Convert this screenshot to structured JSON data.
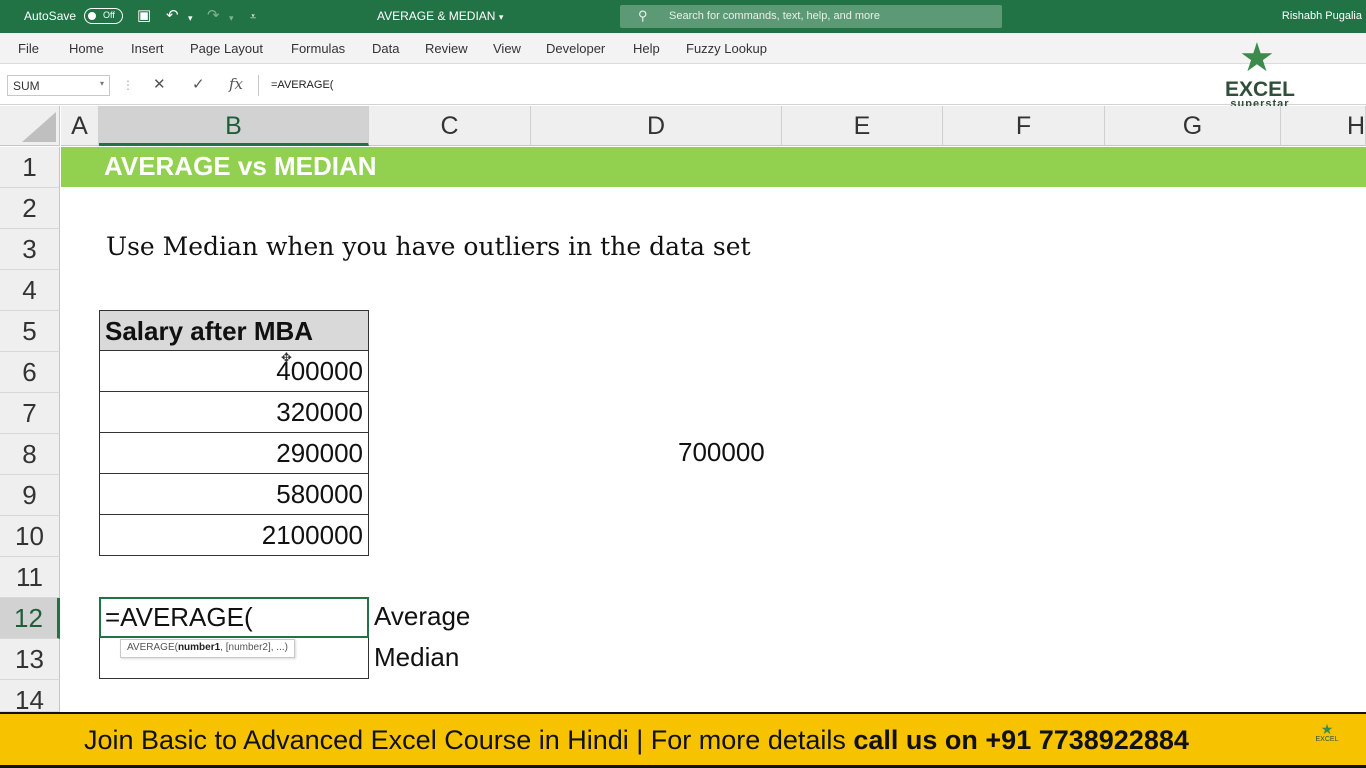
{
  "titlebar": {
    "autosave_label": "AutoSave",
    "autosave_state": "Off",
    "document_title": "AVERAGE & MEDIAN",
    "search_placeholder": "Search for commands, text, help, and more",
    "user_name": "Rishabh Pugalia"
  },
  "ribbon": {
    "tabs": [
      "File",
      "Home",
      "Insert",
      "Page Layout",
      "Formulas",
      "Data",
      "Review",
      "View",
      "Developer",
      "Help",
      "Fuzzy Lookup"
    ]
  },
  "formula_bar": {
    "name_box": "SUM",
    "formula": "=AVERAGE("
  },
  "logo": {
    "word1": "EXCEL",
    "word2": "superstar"
  },
  "columns": [
    "A",
    "B",
    "C",
    "D",
    "E",
    "F",
    "G",
    "H"
  ],
  "rows": [
    "1",
    "2",
    "3",
    "4",
    "5",
    "6",
    "7",
    "8",
    "9",
    "10",
    "11",
    "12",
    "13",
    "14"
  ],
  "sheet": {
    "banner": "AVERAGE vs MEDIAN",
    "subtitle": "Use Median when you have outliers in the data set",
    "table_header": "Salary after MBA",
    "salaries": [
      "400000",
      "320000",
      "290000",
      "580000",
      "2100000"
    ],
    "d8_value": "700000",
    "edit_cell": "=AVERAGE(",
    "tooltip_fn": "AVERAGE(",
    "tooltip_arg1": "number1",
    "tooltip_rest": ", [number2], ...)",
    "label_average": "Average",
    "label_median": "Median"
  },
  "promo": {
    "text_regular": "Join Basic to Advanced Excel Course in Hindi | For more details ",
    "text_bold": "call us on +91 7738922884",
    "mini_logo": "EXCEL"
  },
  "colors": {
    "excel_green": "#217346",
    "banner_green": "#92d050",
    "promo_yellow": "#f7c300"
  }
}
